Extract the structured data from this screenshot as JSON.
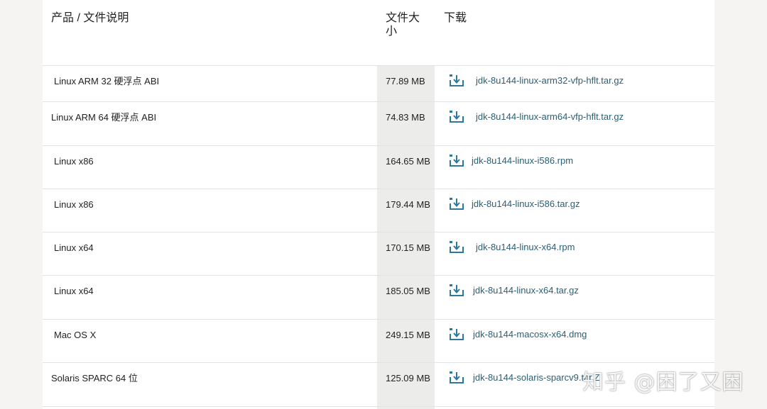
{
  "table": {
    "headers": {
      "product": "产品 / 文件说明",
      "size": "文件大小",
      "download": "下载"
    },
    "rows": [
      {
        "product": "Linux ARM 32 硬浮点 ABI",
        "size": "77.89 MB",
        "file": "jdk-8u144-linux-arm32-vfp-hflt.tar.gz"
      },
      {
        "product": "Linux ARM 64 硬浮点 ABI",
        "size": "74.83 MB",
        "file": "jdk-8u144-linux-arm64-vfp-hflt.tar.gz"
      },
      {
        "product": "Linux x86",
        "size": "164.65 MB",
        "file": "jdk-8u144-linux-i586.rpm"
      },
      {
        "product": "Linux x86",
        "size": "179.44 MB",
        "file": "jdk-8u144-linux-i586.tar.gz"
      },
      {
        "product": "Linux x64",
        "size": "170.15 MB",
        "file": "jdk-8u144-linux-x64.rpm"
      },
      {
        "product": "Linux x64",
        "size": "185.05 MB",
        "file": "jdk-8u144-linux-x64.tar.gz"
      },
      {
        "product": "Mac OS X",
        "size": "249.15 MB",
        "file": "jdk-8u144-macosx-x64.dmg"
      },
      {
        "product": "Solaris SPARC 64 位",
        "size": "125.09 MB",
        "file": "jdk-8u144-solaris-sparcv9.tar.Z"
      }
    ]
  },
  "icons": {
    "download": "download-icon"
  },
  "colors": {
    "link": "#2b5f75",
    "icon": "#2b7a9e",
    "size_column_bg": "#ececea"
  },
  "watermark": "知乎 @困了又困"
}
